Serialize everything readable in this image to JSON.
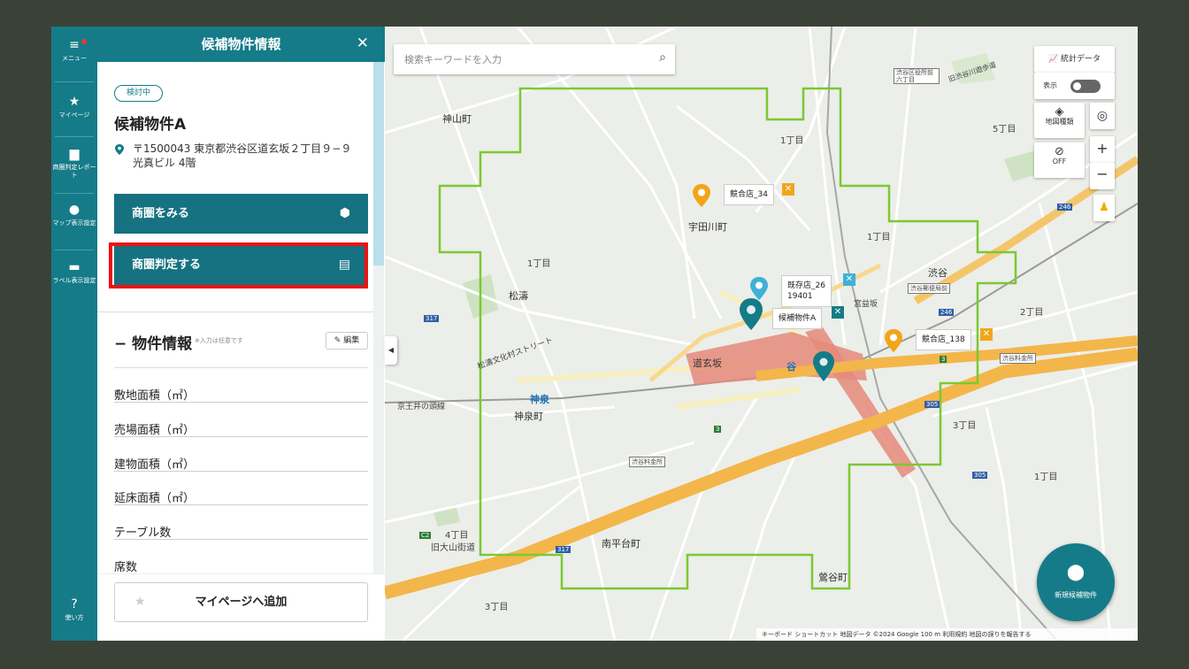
{
  "nav": {
    "items": [
      {
        "label": "メニュー",
        "icon": "hamburger-icon"
      },
      {
        "label": "マイページ",
        "icon": "star-icon"
      },
      {
        "label": "商圏判定レポート",
        "icon": "document-icon"
      },
      {
        "label": "マップ表示設定",
        "icon": "pin-icon"
      },
      {
        "label": "ラベル表示設定",
        "icon": "label-icon"
      },
      {
        "label": "使い方",
        "icon": "help-icon"
      }
    ]
  },
  "panel": {
    "title": "候補物件情報",
    "status_badge": "検討中",
    "property_name": "候補物件A",
    "address": "〒1500043  東京都渋谷区道玄坂２丁目９−９ 光真ビル 4階",
    "btn_trade_area": "商圏をみる",
    "btn_judge": "商圏判定する",
    "section_title": "− 物件情報",
    "section_note": "※入力は任意です",
    "edit_label": "編集",
    "fields": [
      "敷地面積（㎡）",
      "売場面積（㎡）",
      "建物面積（㎡）",
      "延床面積（㎡）",
      "テーブル数",
      "席数"
    ],
    "add_mypage": "マイページへ追加"
  },
  "map": {
    "search_placeholder": "検索キーワードを入力",
    "stats_label": "統計データ",
    "show_label": "表示",
    "maptype_label": "地図種類",
    "off_label": "OFF",
    "markers": {
      "competitor_34": "競合店_34",
      "existing_26": "既存店_26",
      "existing_26_line2": "19401",
      "candidate_a": "候補物件A",
      "competitor_138": "競合店_138"
    },
    "place_labels": {
      "kamiyama": "神山町",
      "udagawa": "宇田川町",
      "shoto": "松濤",
      "dogenzaka": "道玄坂",
      "shinsen_town": "神泉町",
      "nanpeidai": "南平台町",
      "uguisudani": "鶯谷町",
      "shibuya": "渋谷",
      "shinsen_station": "神泉",
      "shibuya_station": "谷",
      "one_chome_a": "1丁目",
      "one_chome_b": "1丁目",
      "one_chome_c": "1丁目",
      "one_chome_d": "1丁目",
      "two_chome": "2丁目",
      "three_chome_a": "3丁目",
      "three_chome_b": "3丁目",
      "four_chome": "4丁目",
      "five_chome": "5丁目",
      "kyu_oyama": "旧大山街道",
      "keio": "京王井の頭線",
      "shoto_bunka": "松濤文化村ストリート",
      "miyamasuzaka": "宮益坂",
      "toll_a": "渋谷料金所",
      "toll_b": "渋谷料金所",
      "post": "渋谷郵便局前",
      "route317a": "317",
      "route317b": "317",
      "route246a": "246",
      "route246b": "246",
      "route305": "305",
      "route305b": "305",
      "route3a": "3",
      "route3b": "3",
      "c2": "C2",
      "shibuya_ku_mae": "渋谷区役所前 六丁目",
      "kyu_tokyu": "旧渋谷川遊歩道"
    },
    "new_candidate": "新規候補物件",
    "footer": "キーボード ショートカット   地図データ ©2024 Google   100 m             利用規約   地図の誤りを報告する",
    "accent_color": "#157b88",
    "trade_area_color": "#7cc832"
  }
}
